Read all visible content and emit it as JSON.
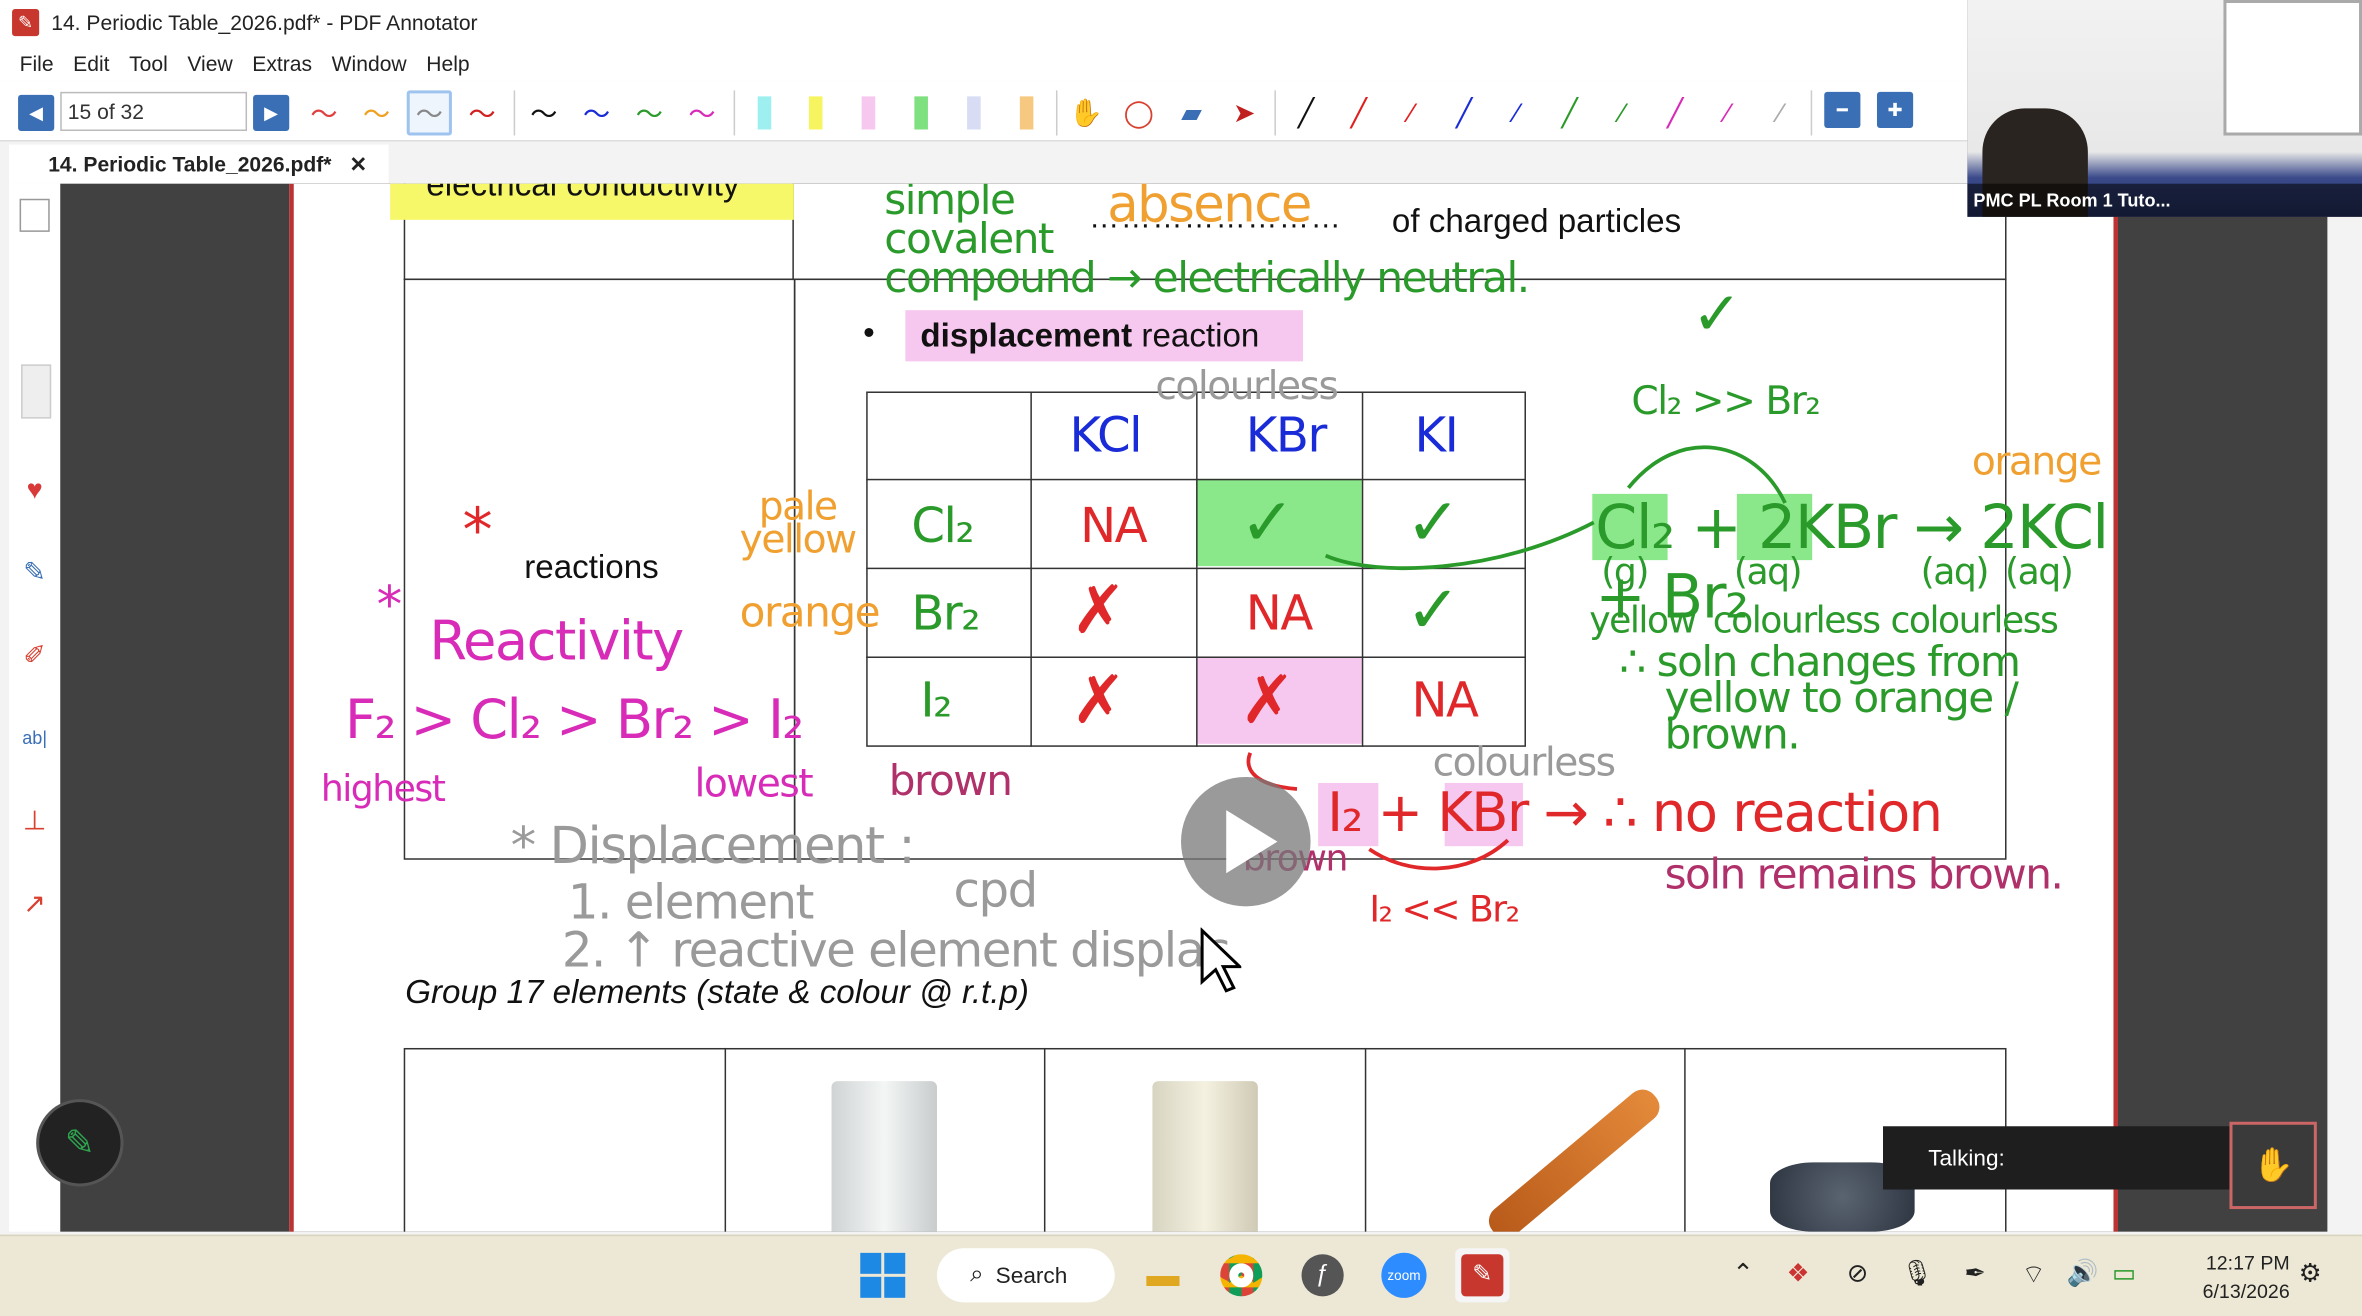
{
  "window": {
    "title": "14. Periodic Table_2026.pdf* - PDF Annotator"
  },
  "menu": [
    "File",
    "Edit",
    "Tool",
    "View",
    "Extras",
    "Window",
    "Help"
  ],
  "toolbar": {
    "page_indicator": "15 of 32",
    "prev": "◀",
    "next": "▶"
  },
  "tab": {
    "label": "14. Periodic Table_2026.pdf*",
    "close": "✕"
  },
  "doc": {
    "header_cell_text": "electrical conductivity",
    "charged_particles": "of charged particles",
    "dots": "……………………",
    "bullet": "•",
    "displacement_bold": "displacement",
    "displacement_rest": " reaction",
    "reactions_label": "reactions",
    "group17_heading": "Group 17 elements (state & colour @ r.t.p)"
  },
  "annotations": {
    "simple_covalent": [
      "simple",
      "covalent",
      "compound → electrically neutral."
    ],
    "absence": "absence",
    "asterisk": "*",
    "reactivity": "Reactivity",
    "series": "F₂ > Cl₂ > Br₂ > I₂",
    "highest": "highest",
    "lowest": "lowest",
    "pale_yellow": [
      "pale",
      "yellow"
    ],
    "orange_left": "orange",
    "brown_bottom": "brown",
    "colourless_top": "colourless",
    "table_headers": [
      "",
      "KCl",
      "KBr",
      "KI"
    ],
    "table_rows": [
      {
        "label": "Cl₂",
        "cells": [
          "NA",
          "✓",
          "✓"
        ]
      },
      {
        "label": "Br₂",
        "cells": [
          "✗",
          "NA",
          "✓"
        ]
      },
      {
        "label": "I₂",
        "cells": [
          "✗",
          "✗",
          "NA"
        ]
      }
    ],
    "cl_gt_br": "Cl₂ >> Br₂",
    "check": "✓",
    "orange_right": "orange",
    "equation_main": "Cl₂ + 2KBr → 2KCl + Br₂",
    "states": [
      "(g)",
      "(aq)",
      "(aq)",
      "(aq)"
    ],
    "colours_under": [
      "yellow",
      "colourless",
      "colourless"
    ],
    "soln_changes": [
      "∴ soln changes from",
      "yellow to orange / brown."
    ],
    "colourless_mid": "colourless",
    "equation_no": "I₂ + KBr → ∴ no reaction",
    "brown_under": "brown",
    "soln_remains": "soln remains brown.",
    "i_lt_br": "I₂ << Br₂",
    "displacement_note": [
      "* Displacement :",
      "1. element",
      "cpd",
      "2. ↑ reactive element displac"
    ]
  },
  "video": {
    "label": "PMC PL Room 1 Tuto..."
  },
  "talking": {
    "label": "Talking:"
  },
  "taskbar": {
    "search": "Search",
    "time": "12:17 PM",
    "date": "6/13/2026"
  },
  "colors": {
    "accent": "#3a6fb5",
    "green": "#2a9a2a",
    "red": "#e0282a",
    "magenta": "#d72bb8",
    "orange": "#f0a030",
    "blue": "#1a2bd8",
    "brown": "#b0306a",
    "gray": "#9a9a9a"
  }
}
